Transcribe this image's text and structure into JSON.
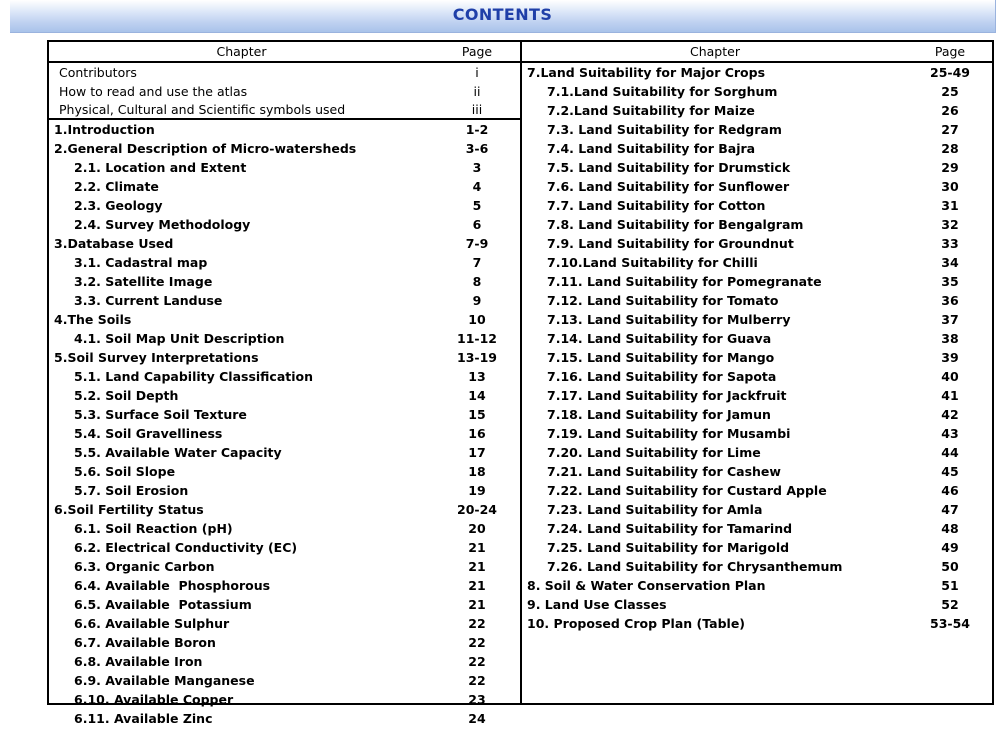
{
  "banner": {
    "title": "CONTENTS",
    "title_color": "#1f3fa8",
    "gradient_top": "#ffffff",
    "gradient_bottom": "#a9c3ea"
  },
  "table": {
    "headers": {
      "chapter_left": "Chapter",
      "page_left": "Page",
      "chapter_right": "Chapter",
      "page_right": "Page"
    },
    "left_column": [
      {
        "title": "Contributors",
        "page": "i",
        "level": "pre"
      },
      {
        "title": "How to read and use the atlas",
        "page": "ii",
        "level": "pre"
      },
      {
        "title": "Physical, Cultural and Scientific symbols used",
        "page": "iii",
        "level": "pre",
        "separator_after": true
      },
      {
        "title": "1.Introduction",
        "page": "1-2",
        "level": "0"
      },
      {
        "title": "2.General Description of Micro-watersheds",
        "page": "3-6",
        "level": "0"
      },
      {
        "title": "2.1. Location and Extent",
        "page": "3",
        "level": "1"
      },
      {
        "title": "2.2. Climate",
        "page": "4",
        "level": "1"
      },
      {
        "title": "2.3. Geology",
        "page": "5",
        "level": "1"
      },
      {
        "title": "2.4. Survey Methodology",
        "page": "6",
        "level": "1"
      },
      {
        "title": "3.Database Used",
        "page": "7-9",
        "level": "0"
      },
      {
        "title": "3.1. Cadastral map",
        "page": "7",
        "level": "1"
      },
      {
        "title": "3.2. Satellite Image",
        "page": "8",
        "level": "1"
      },
      {
        "title": "3.3. Current Landuse",
        "page": "9",
        "level": "1"
      },
      {
        "title": "4.The Soils",
        "page": "10",
        "level": "0"
      },
      {
        "title": "4.1. Soil Map Unit Description",
        "page": "11-12",
        "level": "1"
      },
      {
        "title": "5.Soil Survey Interpretations",
        "page": "13-19",
        "level": "0"
      },
      {
        "title": "5.1. Land Capability Classification",
        "page": "13",
        "level": "1"
      },
      {
        "title": "5.2. Soil Depth",
        "page": "14",
        "level": "1"
      },
      {
        "title": "5.3. Surface Soil Texture",
        "page": "15",
        "level": "1"
      },
      {
        "title": "5.4. Soil Gravelliness",
        "page": "16",
        "level": "1"
      },
      {
        "title": "5.5. Available Water Capacity",
        "page": "17",
        "level": "1"
      },
      {
        "title": "5.6. Soil Slope",
        "page": "18",
        "level": "1"
      },
      {
        "title": "5.7. Soil Erosion",
        "page": "19",
        "level": "1"
      },
      {
        "title": "6.Soil Fertility Status",
        "page": "20-24",
        "level": "0"
      },
      {
        "title": "6.1. Soil Reaction (pH)",
        "page": "20",
        "level": "1"
      },
      {
        "title": "6.2. Electrical Conductivity (EC)",
        "page": "21",
        "level": "1"
      },
      {
        "title": "6.3. Organic Carbon",
        "page": "21",
        "level": "1"
      },
      {
        "title": "6.4. Available  Phosphorous",
        "page": "21",
        "level": "1"
      },
      {
        "title": "6.5. Available  Potassium",
        "page": "21",
        "level": "1"
      },
      {
        "title": "6.6. Available Sulphur",
        "page": "22",
        "level": "1"
      },
      {
        "title": "6.7. Available Boron",
        "page": "22",
        "level": "1"
      },
      {
        "title": "6.8. Available Iron",
        "page": "22",
        "level": "1"
      },
      {
        "title": "6.9. Available Manganese",
        "page": "22",
        "level": "1"
      },
      {
        "title": "6.10. Available Copper",
        "page": "23",
        "level": "1"
      },
      {
        "title": "6.11. Available Zinc",
        "page": "24",
        "level": "1"
      }
    ],
    "right_column": [
      {
        "title": "7.Land Suitability for Major Crops",
        "page": "25-49",
        "level": "0"
      },
      {
        "title": "7.1.Land Suitability for Sorghum",
        "page": "25",
        "level": "1"
      },
      {
        "title": "7.2.Land Suitability for Maize",
        "page": "26",
        "level": "1"
      },
      {
        "title": "7.3. Land Suitability for Redgram",
        "page": "27",
        "level": "1"
      },
      {
        "title": "7.4. Land Suitability for Bajra",
        "page": "28",
        "level": "1"
      },
      {
        "title": "7.5. Land Suitability for Drumstick",
        "page": "29",
        "level": "1"
      },
      {
        "title": "7.6. Land Suitability for Sunflower",
        "page": "30",
        "level": "1"
      },
      {
        "title": "7.7. Land Suitability for Cotton",
        "page": "31",
        "level": "1"
      },
      {
        "title": "7.8. Land Suitability for Bengalgram",
        "page": "32",
        "level": "1"
      },
      {
        "title": "7.9. Land Suitability for Groundnut",
        "page": "33",
        "level": "1"
      },
      {
        "title": "7.10.Land Suitability for Chilli",
        "page": "34",
        "level": "1"
      },
      {
        "title": "7.11. Land Suitability for Pomegranate",
        "page": "35",
        "level": "1"
      },
      {
        "title": "7.12. Land Suitability for Tomato",
        "page": "36",
        "level": "1"
      },
      {
        "title": "7.13. Land Suitability for Mulberry",
        "page": "37",
        "level": "1"
      },
      {
        "title": "7.14. Land Suitability for Guava",
        "page": "38",
        "level": "1"
      },
      {
        "title": "7.15. Land Suitability for Mango",
        "page": "39",
        "level": "1"
      },
      {
        "title": "7.16. Land Suitability for Sapota",
        "page": "40",
        "level": "1"
      },
      {
        "title": "7.17. Land Suitability for Jackfruit",
        "page": "41",
        "level": "1"
      },
      {
        "title": "7.18. Land Suitability for Jamun",
        "page": "42",
        "level": "1"
      },
      {
        "title": "7.19. Land Suitability for Musambi",
        "page": "43",
        "level": "1"
      },
      {
        "title": "7.20. Land Suitability for Lime",
        "page": "44",
        "level": "1"
      },
      {
        "title": "7.21. Land Suitability for Cashew",
        "page": "45",
        "level": "1"
      },
      {
        "title": "7.22. Land Suitability for Custard Apple",
        "page": "46",
        "level": "1"
      },
      {
        "title": "7.23. Land Suitability for Amla",
        "page": "47",
        "level": "1"
      },
      {
        "title": "7.24. Land Suitability for Tamarind",
        "page": "48",
        "level": "1"
      },
      {
        "title": "7.25. Land Suitability for Marigold",
        "page": "49",
        "level": "1"
      },
      {
        "title": "7.26. Land Suitability for Chrysanthemum",
        "page": "50",
        "level": "1"
      },
      {
        "title": "8. Soil & Water Conservation Plan",
        "page": "51",
        "level": "0"
      },
      {
        "title": "9. Land Use Classes",
        "page": "52",
        "level": "0"
      },
      {
        "title": "10. Proposed Crop Plan (Table)",
        "page": "53-54",
        "level": "0"
      }
    ]
  }
}
